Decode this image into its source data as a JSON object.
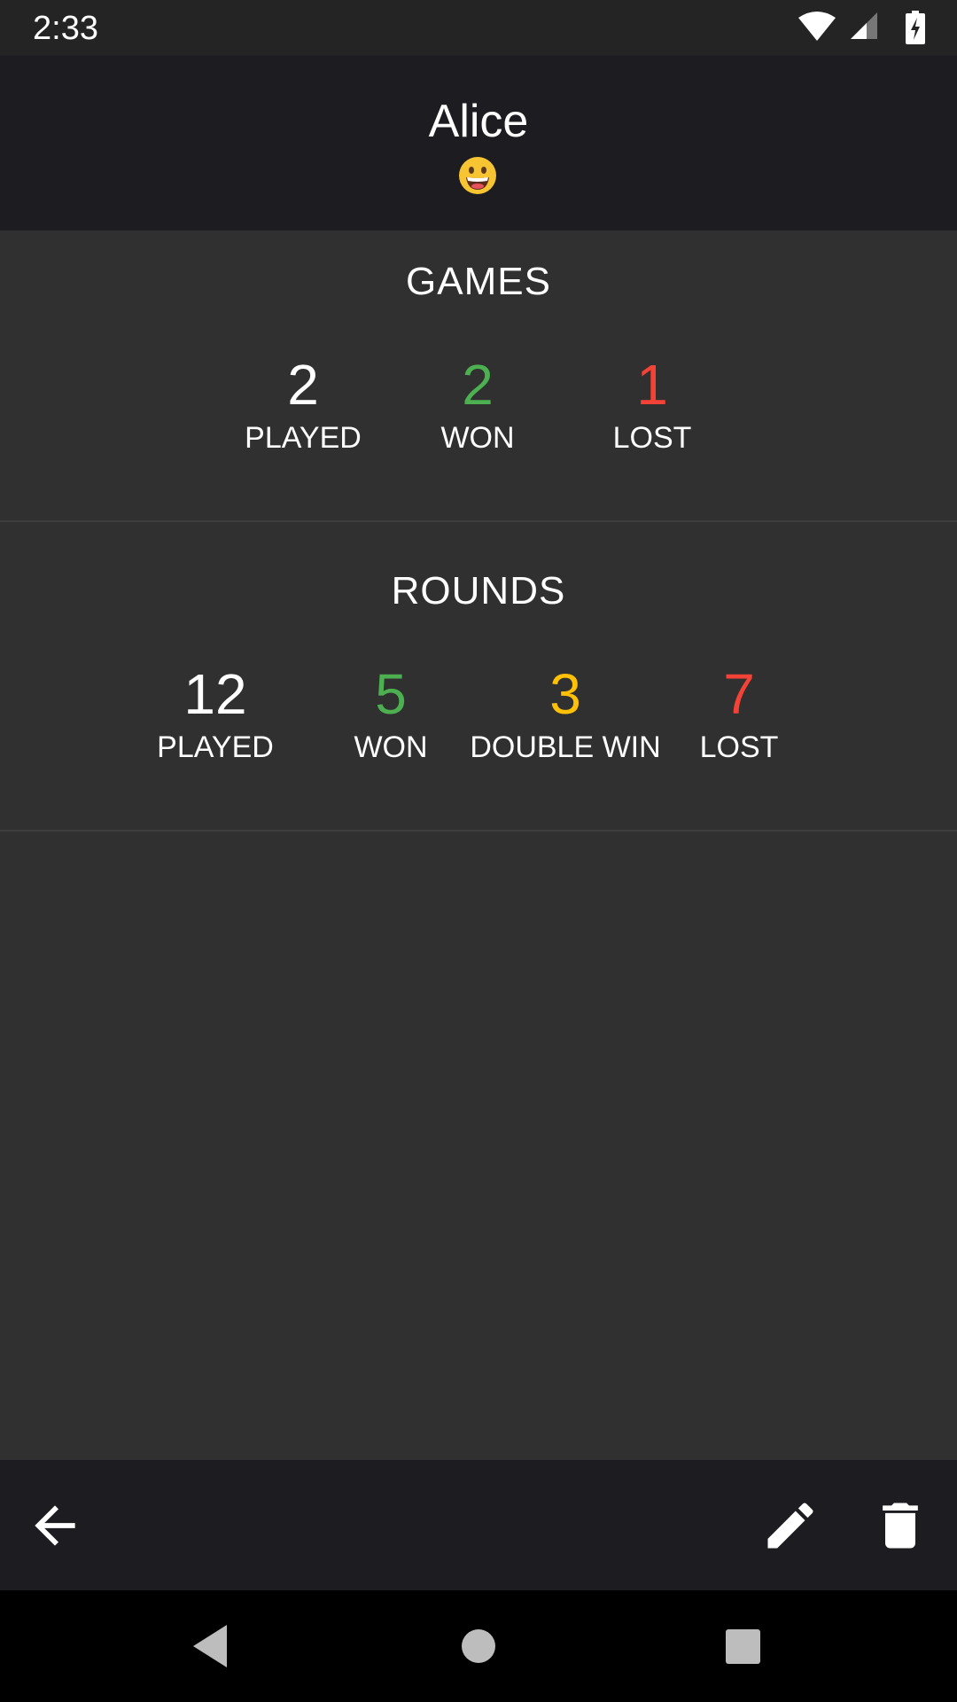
{
  "status_bar": {
    "time": "2:33"
  },
  "header": {
    "name": "Alice",
    "emoji_icon": "grinning-face-emoji"
  },
  "games": {
    "title": "GAMES",
    "stats": [
      {
        "value": "2",
        "label": "PLAYED",
        "color": "#ffffff"
      },
      {
        "value": "2",
        "label": "WON",
        "color": "#4caf50"
      },
      {
        "value": "1",
        "label": "LOST",
        "color": "#f44336"
      }
    ]
  },
  "rounds": {
    "title": "ROUNDS",
    "stats": [
      {
        "value": "12",
        "label": "PLAYED",
        "color": "#ffffff"
      },
      {
        "value": "5",
        "label": "WON",
        "color": "#4caf50"
      },
      {
        "value": "3",
        "label": "DOUBLE WIN",
        "color": "#ffc107"
      },
      {
        "value": "7",
        "label": "LOST",
        "color": "#f44336"
      }
    ]
  },
  "toolbar": {
    "back_icon": "arrow-back-icon",
    "edit_icon": "pencil-edit-icon",
    "delete_icon": "trash-delete-icon"
  },
  "nav_bar": {
    "back_icon": "triangle-back-icon",
    "home_icon": "circle-home-icon",
    "recents_icon": "square-recents-icon"
  },
  "colors": {
    "background": "#303030",
    "header": "#1d1d21",
    "won": "#4caf50",
    "lost": "#f44336",
    "double_win": "#ffc107"
  }
}
